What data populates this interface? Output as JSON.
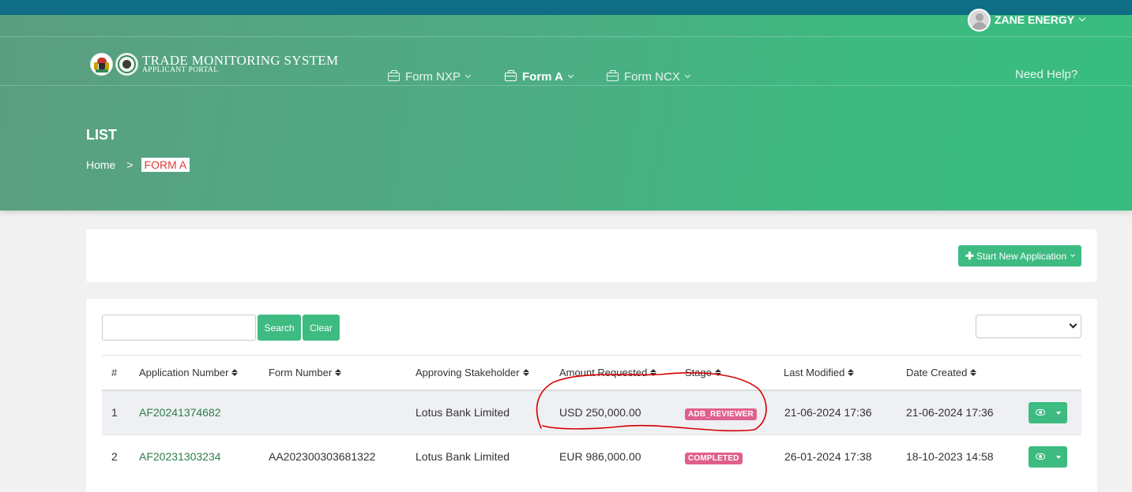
{
  "header": {
    "user_name": "ZANE ENERGY",
    "logo_title": "TRADE MONITORING SYSTEM",
    "logo_subtitle": "APPLICANT PORTAL",
    "nav": [
      {
        "label": "Form NXP"
      },
      {
        "label": "Form A"
      },
      {
        "label": "Form NCX"
      }
    ],
    "help": "Need Help?"
  },
  "page": {
    "title": "LIST",
    "breadcrumb": {
      "home": "Home",
      "separator": ">",
      "current": "FORM A"
    }
  },
  "toolbar": {
    "start_new_label": "Start New Application",
    "search_placeholder": "",
    "search_label": "Search",
    "clear_label": "Clear"
  },
  "table": {
    "columns": [
      "#",
      "Application Number",
      "Form Number",
      "Approving Stakeholder",
      "Amount Requested",
      "Stage",
      "Last Modified",
      "Date Created"
    ],
    "rows": [
      {
        "num": "1",
        "application_number": "AF20241374682",
        "form_number": "",
        "stakeholder": "Lotus Bank Limited",
        "amount": "USD 250,000.00",
        "stage": "ADB_REVIEWER",
        "last_modified": "21-06-2024 17:36",
        "date_created": "21-06-2024 17:36"
      },
      {
        "num": "2",
        "application_number": "AF20231303234",
        "form_number": "AA202300303681322",
        "stakeholder": "Lotus Bank Limited",
        "amount": "EUR 986,000.00",
        "stage": "COMPLETED",
        "last_modified": "26-01-2024 17:38",
        "date_created": "18-10-2023 14:58"
      }
    ]
  },
  "colors": {
    "accent": "#3dbb81",
    "topstrip": "#0f6d84",
    "badge": "#e15f8c",
    "link": "#2e7d4a",
    "breadcrumb_active": "#e03b3b",
    "annotation": "#d40000"
  },
  "icons": {
    "briefcase": "briefcase-icon",
    "eye": "eye-icon",
    "plus": "plus-icon",
    "sort": "sort-icon"
  }
}
